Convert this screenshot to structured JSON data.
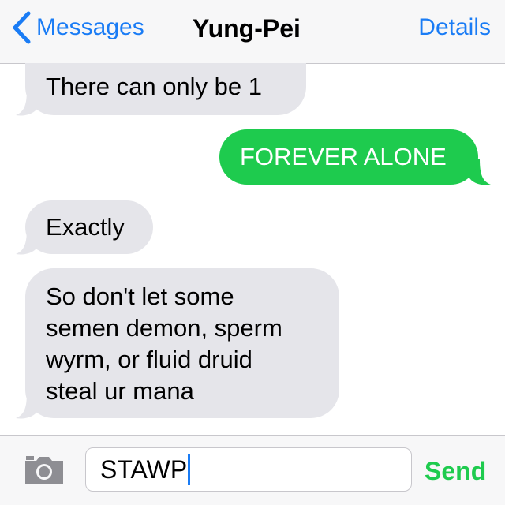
{
  "navbar": {
    "back_label": "Messages",
    "title": "Yung-Pei",
    "details_label": "Details"
  },
  "messages": [
    {
      "direction": "incoming",
      "text": "There can only be 1"
    },
    {
      "direction": "outgoing",
      "text": "FOREVER ALONE"
    },
    {
      "direction": "incoming",
      "text": "Exactly"
    },
    {
      "direction": "incoming",
      "lines": [
        "So don't let some",
        "semen demon, sperm",
        "wyrm, or fluid druid",
        "steal ur mana"
      ]
    }
  ],
  "composer": {
    "input_value": "STAWP",
    "send_label": "Send",
    "camera_icon": "camera-icon"
  },
  "colors": {
    "ios_blue": "#1a7cf5",
    "imessage_green": "#1ecb4e",
    "incoming_bubble": "#e5e5ea"
  }
}
